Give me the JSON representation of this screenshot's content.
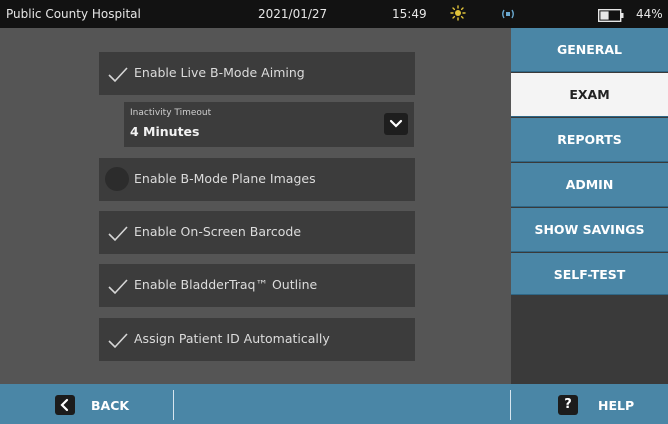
{
  "status_bar": {
    "hospital": "Public County Hospital",
    "date": "2021/01/27",
    "time": "15:49",
    "battery_percent": "44%",
    "battery_level": 0.44,
    "icons": [
      "brightness-icon",
      "volume-icon",
      "battery-icon"
    ]
  },
  "options": [
    {
      "label": "Enable Live B-Mode Aiming",
      "checked": true
    },
    {
      "label": "Enable B-Mode Plane Images",
      "checked": false
    },
    {
      "label": "Enable On-Screen Barcode",
      "checked": true
    },
    {
      "label": "Enable BladderTraq™ Outline",
      "checked": true
    },
    {
      "label": "Assign Patient ID Automatically",
      "checked": true
    }
  ],
  "inactivity": {
    "label": "Inactivity Timeout",
    "value": "4 Minutes"
  },
  "menu": {
    "items": [
      {
        "label": "GENERAL",
        "active": false
      },
      {
        "label": "EXAM",
        "active": true
      },
      {
        "label": "REPORTS",
        "active": false
      },
      {
        "label": "ADMIN",
        "active": false
      },
      {
        "label": "SHOW SAVINGS",
        "active": false
      },
      {
        "label": "SELF-TEST",
        "active": false
      }
    ]
  },
  "bottom_bar": {
    "back_label": "BACK",
    "help_label": "HELP",
    "help_icon_glyph": "?"
  },
  "colors": {
    "accent": "#4a86a6",
    "background": "#545454",
    "panel": "#3c3c3c",
    "status_bar": "#121212",
    "active_menu": "#f4f4f4"
  }
}
